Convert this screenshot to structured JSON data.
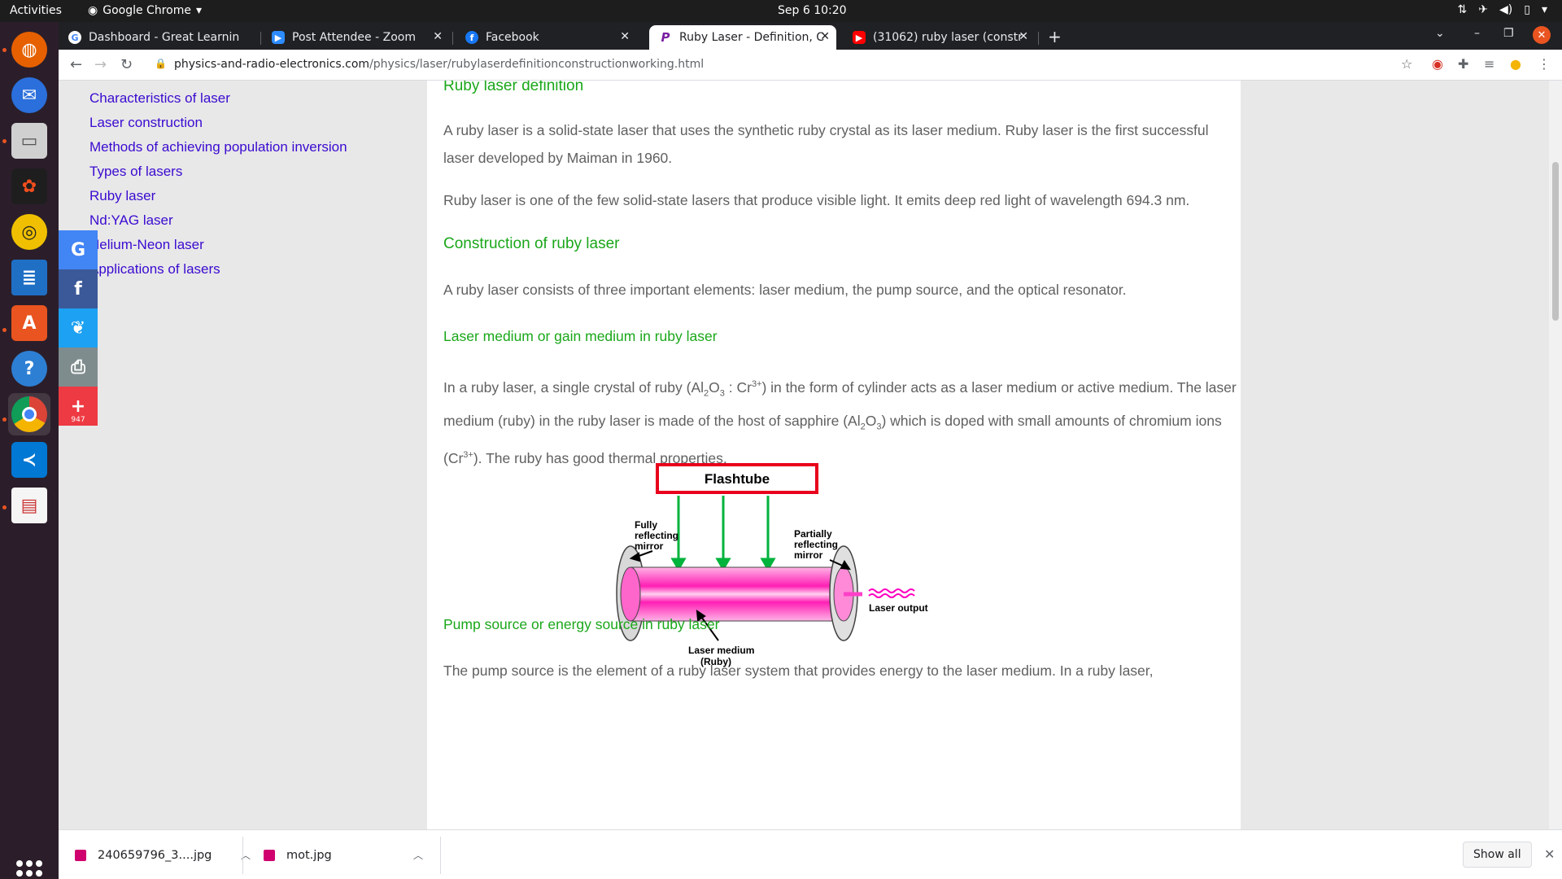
{
  "topbar": {
    "activities": "Activities",
    "app_name": "Google Chrome",
    "clock": "Sep 6  10:20"
  },
  "tabs": [
    {
      "label": "Dashboard - Great Learnin",
      "icon": "google-icon",
      "color": "#ffffff"
    },
    {
      "label": "Post Attendee - Zoom",
      "icon": "zoom-icon",
      "color": "#2d8cff"
    },
    {
      "label": "Facebook",
      "icon": "facebook-icon",
      "color": "#1877f2"
    },
    {
      "label": "Ruby Laser - Definition, C",
      "icon": "p-icon",
      "color": "#7b1fa2",
      "active": true
    },
    {
      "label": "(31062) ruby laser (constr",
      "icon": "youtube-icon",
      "color": "#ff0000"
    }
  ],
  "address": {
    "domain": "physics-and-radio-electronics.com",
    "path": "/physics/laser/rubylaserdefinitionconstructionworking.html"
  },
  "sidebar_links": [
    "Characteristics of laser",
    "Laser construction",
    "Methods of achieving population inversion",
    "Types of lasers",
    "Ruby laser",
    "Nd:YAG laser",
    "Helium-Neon laser",
    "Applications of lasers"
  ],
  "share": {
    "count": "947"
  },
  "content": {
    "h_definition": "Ruby laser definition",
    "p_definition_1": "A ruby laser is a solid-state laser that uses the synthetic ruby crystal as its laser medium. Ruby laser is the first successful laser developed by Maiman in 1960.",
    "p_definition_2": "Ruby laser is one of the few solid-state lasers that produce visible light. It emits deep red light of wavelength 694.3 nm.",
    "h_construction": "Construction of ruby laser",
    "p_construction": "A ruby laser consists of three important elements: laser medium, the pump source, and the optical resonator.",
    "h_medium": "Laser medium or gain medium in ruby laser",
    "p_medium_a": "In a ruby laser, a single crystal of ruby (Al",
    "p_medium_sub1": "2",
    "p_medium_b": "O",
    "p_medium_sub2": "3",
    "p_medium_c": " : Cr",
    "p_medium_sup1": "3+",
    "p_medium_d": ") in the form of cylinder acts as a laser medium or active medium. The laser medium (ruby) in the ruby laser is made of the host of sapphire (Al",
    "p_medium_sub3": "2",
    "p_medium_e": "O",
    "p_medium_sub4": "3",
    "p_medium_f": ") which is doped with small amounts of chromium ions (Cr",
    "p_medium_sup2": "3+",
    "p_medium_g": "). The ruby has good thermal properties.",
    "h_pump": "Pump source or energy source in ruby laser",
    "p_pump": "The pump source is the element of a ruby laser system that provides energy to the laser medium. In a ruby laser,"
  },
  "diagram": {
    "flashtube": "Flashtube",
    "full_mirror_1": "Fully",
    "full_mirror_2": "reflecting",
    "full_mirror_3": "mirror",
    "partial_mirror_1": "Partially",
    "partial_mirror_2": "reflecting",
    "partial_mirror_3": "mirror",
    "laser_medium_1": "Laser medium",
    "laser_medium_2": "(Ruby)",
    "laser_output": "Laser output"
  },
  "downloads": [
    {
      "name": "240659796_3....jpg"
    },
    {
      "name": "mot.jpg"
    }
  ],
  "shelf": {
    "show_all": "Show all"
  }
}
